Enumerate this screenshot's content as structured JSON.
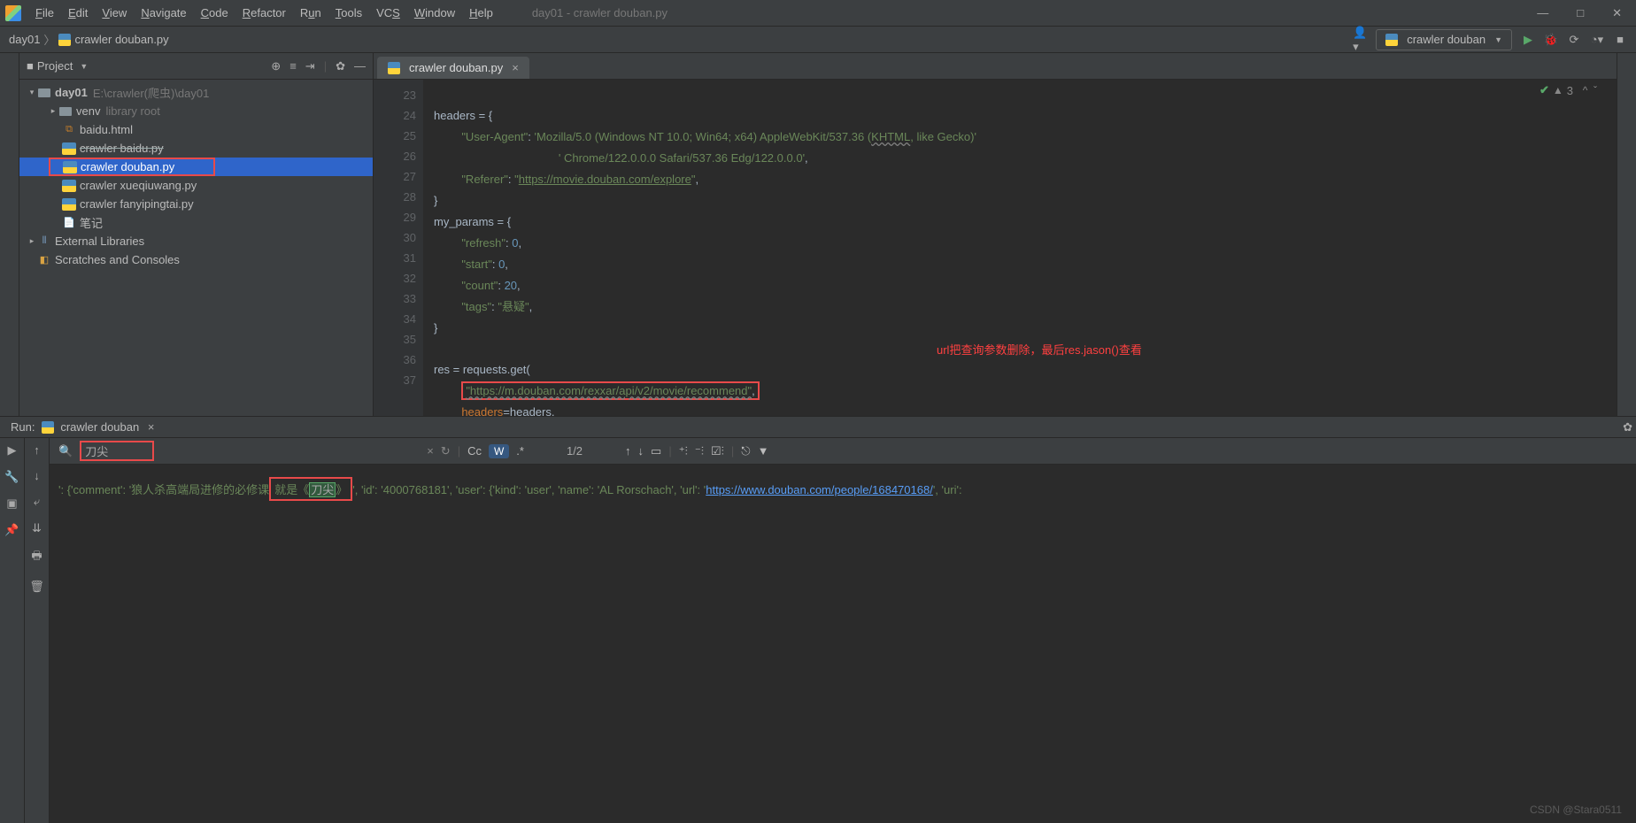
{
  "menu": {
    "file": "File",
    "edit": "Edit",
    "view": "View",
    "navigate": "Navigate",
    "code": "Code",
    "refactor": "Refactor",
    "run": "Run",
    "tools": "Tools",
    "vcs": "VCS",
    "window": "Window",
    "help": "Help"
  },
  "window_title": "day01 - crawler douban.py",
  "breadcrumb": {
    "root": "day01",
    "file": "crawler douban.py"
  },
  "run_config": "crawler douban",
  "project_pane": {
    "title": "Project",
    "root": {
      "name": "day01",
      "path": "E:\\crawler(爬虫)\\day01"
    },
    "venv": {
      "name": "venv",
      "hint": "library root"
    },
    "files": {
      "baidu": "baidu.html",
      "crawler_baidu": "crawler baidu.py",
      "crawler_douban": "crawler douban.py",
      "crawler_xueqiu": "crawler xueqiuwang.py",
      "crawler_fanyi": "crawler  fanyipingtai.py",
      "biji": "笔记"
    },
    "external": "External Libraries",
    "scratches": "Scratches and Consoles"
  },
  "tab": "crawler douban.py",
  "editor": {
    "lines": [
      "23",
      "24",
      "25",
      "26",
      "27",
      "28",
      "29",
      "30",
      "31",
      "32",
      "33",
      "34",
      "35",
      "36",
      "37"
    ],
    "l23": "headers = {",
    "l24a": "\"User-Agent\"",
    "l24b": ": ",
    "l24c": "'Mozilla/5.0 (Windows NT 10.0; Win64; x64) AppleWebKit/537.36 (",
    "l24d": "KHTML",
    "l24e": ", like Gecko)'",
    "l25": "' Chrome/122.0.0.0 Safari/537.36 Edg/122.0.0.0'",
    "l25b": ",",
    "l26a": "\"Referer\"",
    "l26b": ": ",
    "l26c": "\"",
    "l26d": "https://movie.douban.com/explore",
    "l26e": "\"",
    "l26f": ",",
    "l27": "}",
    "l28": "my_params = {",
    "l29a": "\"refresh\"",
    "l29b": ": ",
    "l29c": "0",
    "l29d": ",",
    "l30a": "\"start\"",
    "l30b": ": ",
    "l30c": "0",
    "l30d": ",",
    "l31a": "\"count\"",
    "l31b": ": ",
    "l31c": "20",
    "l31d": ",",
    "l32a": "\"tags\"",
    "l32b": ": ",
    "l32c": "\"悬疑\"",
    "l32d": ",",
    "l33": "}",
    "l35a": "res = requests.get(",
    "l36": "\"https://m.douban.com/rexxar/api/v2/movie/recommend\"",
    "l36b": ",",
    "l37a": "headers",
    "l37b": "=headers,",
    "anno": "url把查询参数删除，最后res.jason()查看",
    "status": "3"
  },
  "run_panel": {
    "label": "Run:",
    "tab": "crawler douban",
    "search_value": "刀尖",
    "count": "1/2",
    "out_pre": "': {'comment': '狼人杀高端局进修的必修课",
    "out_mid1": "就是《",
    "out_hl": "刀尖",
    "out_mid2": "》",
    "out_post1": "', 'id': '4000768181', 'user': {'kind': 'user', 'name': 'AL Rorschach', 'url': '",
    "out_link": "https://www.douban.com/people/168470168/",
    "out_post2": "', 'uri':"
  },
  "watermark": "CSDN @Stara0511"
}
